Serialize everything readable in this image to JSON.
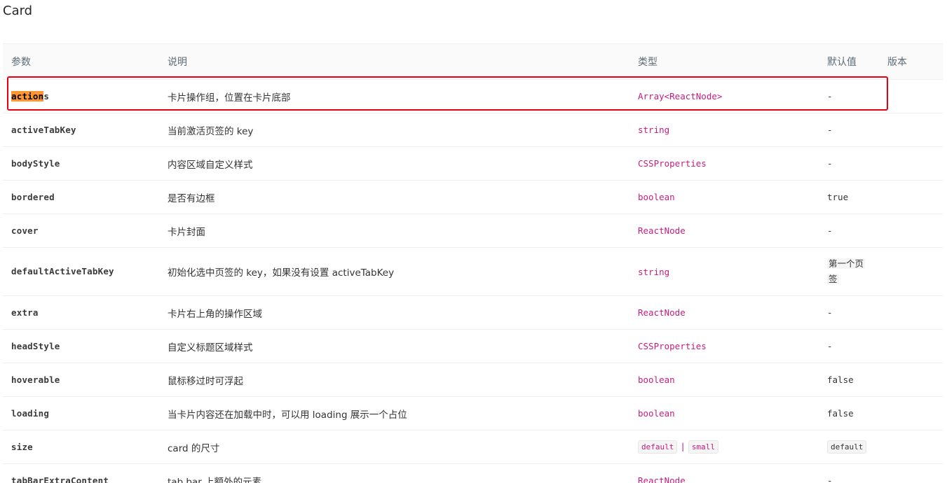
{
  "page": {
    "title": "Card"
  },
  "table": {
    "headers": {
      "param": "参数",
      "desc": "说明",
      "type": "类型",
      "default": "默认值",
      "version": "版本"
    },
    "rows": [
      {
        "param_hl": "action",
        "param_rest": "s",
        "desc": "卡片操作组，位置在卡片底部",
        "type": "Array<ReactNode>",
        "default": "-"
      },
      {
        "param": "activeTabKey",
        "desc": "当前激活页签的 key",
        "type": "string",
        "default": "-"
      },
      {
        "param": "bodyStyle",
        "desc": "内容区域自定义样式",
        "type": "CSSProperties",
        "default": "-"
      },
      {
        "param": "bordered",
        "desc": "是否有边框",
        "type": "boolean",
        "default": "true"
      },
      {
        "param": "cover",
        "desc": "卡片封面",
        "type": "ReactNode",
        "default": "-"
      },
      {
        "param": "defaultActiveTabKey",
        "desc": "初始化选中页签的 key，如果没有设置 activeTabKey",
        "type": "string",
        "default_line1": "第一个页",
        "default_line2": "签"
      },
      {
        "param": "extra",
        "desc": "卡片右上角的操作区域",
        "type": "ReactNode",
        "default": "-"
      },
      {
        "param": "headStyle",
        "desc": "自定义标题区域样式",
        "type": "CSSProperties",
        "default": "-"
      },
      {
        "param": "hoverable",
        "desc": "鼠标移过时可浮起",
        "type": "boolean",
        "default": "false"
      },
      {
        "param": "loading",
        "desc": "当卡片内容还在加载中时，可以用 loading 展示一个占位",
        "type": "boolean",
        "default": "false"
      },
      {
        "param": "size",
        "desc": "card 的尺寸",
        "type_opt1": "default",
        "type_sep": "|",
        "type_opt2": "small",
        "default": "default"
      },
      {
        "param": "tabBarExtraContent",
        "desc": "tab bar 上额外的元素",
        "type": "ReactNode",
        "default": "-"
      }
    ]
  },
  "colors": {
    "highlight": "#ff9632",
    "frame": "#e60012",
    "type_text": "#c41d7f"
  }
}
